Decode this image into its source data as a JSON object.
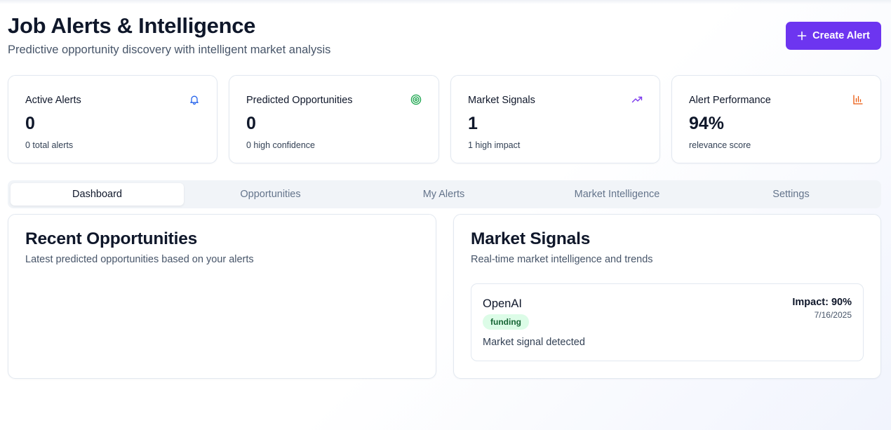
{
  "header": {
    "title": "Job Alerts & Intelligence",
    "subtitle": "Predictive opportunity discovery with intelligent market analysis",
    "create_button_label": "Create Alert"
  },
  "stats": [
    {
      "label": "Active Alerts",
      "value": "0",
      "sub": "0 total alerts",
      "icon": "bell-icon",
      "icon_color": "#2563eb"
    },
    {
      "label": "Predicted Opportunities",
      "value": "0",
      "sub": "0 high confidence",
      "icon": "target-icon",
      "icon_color": "#16a34a"
    },
    {
      "label": "Market Signals",
      "value": "1",
      "sub": "1 high impact",
      "icon": "trending-up-icon",
      "icon_color": "#7c3aed"
    },
    {
      "label": "Alert Performance",
      "value": "94%",
      "sub": "relevance score",
      "icon": "bar-chart-icon",
      "icon_color": "#ea580c"
    }
  ],
  "tabs": [
    {
      "label": "Dashboard",
      "active": true
    },
    {
      "label": "Opportunities",
      "active": false
    },
    {
      "label": "My Alerts",
      "active": false
    },
    {
      "label": "Market Intelligence",
      "active": false
    },
    {
      "label": "Settings",
      "active": false
    }
  ],
  "recent_opportunities": {
    "title": "Recent Opportunities",
    "description": "Latest predicted opportunities based on your alerts"
  },
  "market_signals": {
    "title": "Market Signals",
    "description": "Real-time market intelligence and trends",
    "items": [
      {
        "company": "OpenAI",
        "tag": "funding",
        "description": "Market signal detected",
        "impact": "Impact: 90%",
        "date": "7/16/2025"
      }
    ]
  },
  "colors": {
    "accent": "#6d35f0",
    "badge_bg": "#dcfce7",
    "badge_text": "#166534"
  }
}
